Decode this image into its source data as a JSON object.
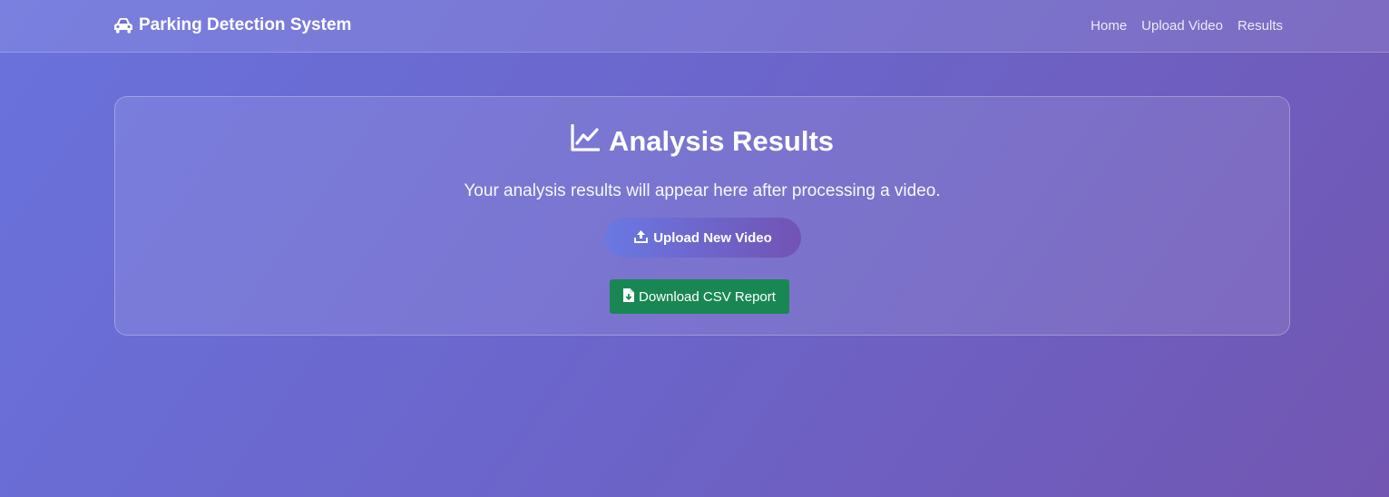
{
  "navbar": {
    "brand": "Parking Detection System",
    "brand_icon": "car-icon",
    "links": [
      "Home",
      "Upload Video",
      "Results"
    ]
  },
  "card": {
    "title": "Analysis Results",
    "title_icon": "chart-line-icon",
    "message": "Your analysis results will appear here after processing a video.",
    "upload_button": {
      "label": "Upload New Video",
      "icon": "upload-icon"
    },
    "download_button": {
      "label": "Download CSV Report",
      "icon": "file-download-icon",
      "color": "#198754"
    }
  }
}
